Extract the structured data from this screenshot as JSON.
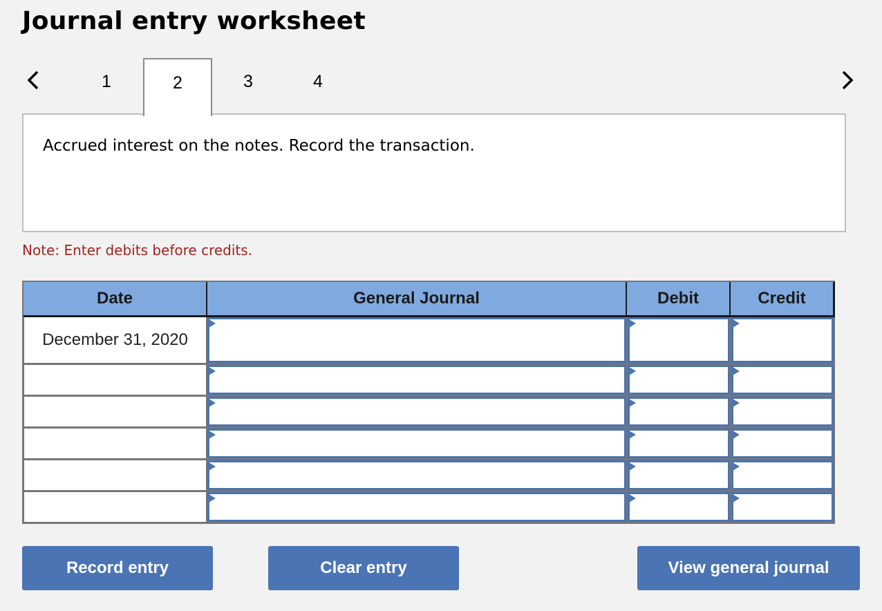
{
  "header": {
    "title": "Journal entry worksheet"
  },
  "navigation": {
    "prev_icon": "chevron-left-icon",
    "next_icon": "chevron-right-icon",
    "tabs": [
      {
        "label": "1",
        "active": false
      },
      {
        "label": "2",
        "active": true
      },
      {
        "label": "3",
        "active": false
      },
      {
        "label": "4",
        "active": false
      }
    ]
  },
  "prompt": {
    "text": "Accrued interest on the notes. Record the transaction."
  },
  "note": {
    "text": "Note: Enter debits before credits."
  },
  "journal": {
    "columns": [
      "Date",
      "General Journal",
      "Debit",
      "Credit"
    ],
    "rows": [
      {
        "date": "December 31, 2020",
        "account": "",
        "debit": "",
        "credit": ""
      },
      {
        "date": "",
        "account": "",
        "debit": "",
        "credit": ""
      },
      {
        "date": "",
        "account": "",
        "debit": "",
        "credit": ""
      },
      {
        "date": "",
        "account": "",
        "debit": "",
        "credit": ""
      },
      {
        "date": "",
        "account": "",
        "debit": "",
        "credit": ""
      },
      {
        "date": "",
        "account": "",
        "debit": "",
        "credit": ""
      }
    ]
  },
  "buttons": {
    "record": "Record entry",
    "clear": "Clear entry",
    "view": "View general journal"
  },
  "colors": {
    "accent": "#4a74b3",
    "header_bg": "#80aadf",
    "note": "#a3221f",
    "background": "#f2f2f2"
  }
}
